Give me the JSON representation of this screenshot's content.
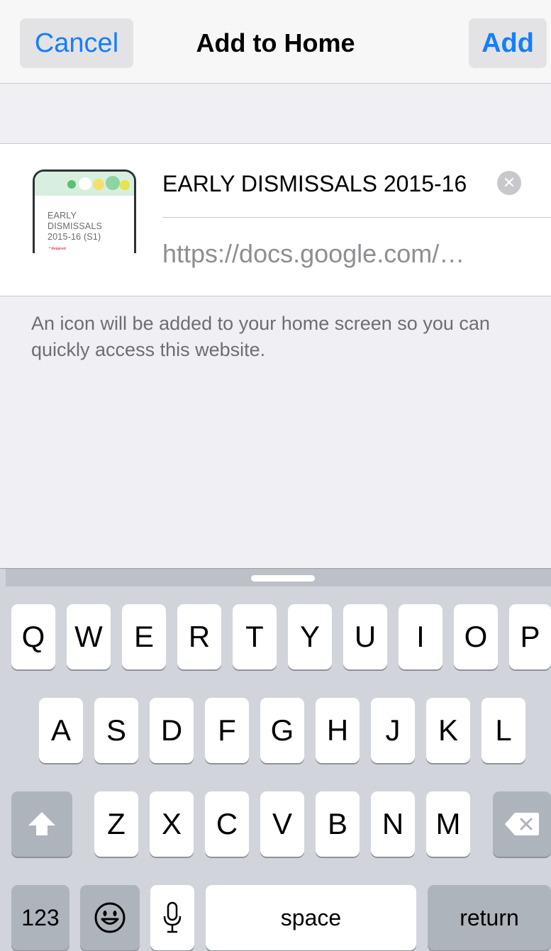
{
  "navbar": {
    "cancel_label": "Cancel",
    "title": "Add to Home",
    "add_label": "Add"
  },
  "bookmark": {
    "thumbnail_lines": [
      "EARLY",
      "DISMISSALS",
      "2015-16 (S1)"
    ],
    "thumbnail_required": "* Required",
    "title_value": "EARLY DISMISSALS 2015-16",
    "clear_icon": "clear-circle-icon",
    "url": "https://docs.google.com/…"
  },
  "info_text": "An icon will be added to your home screen so you can quickly access this website.",
  "keyboard": {
    "row1": [
      "Q",
      "W",
      "E",
      "R",
      "T",
      "Y",
      "U",
      "I",
      "O",
      "P"
    ],
    "row2": [
      "A",
      "S",
      "D",
      "F",
      "G",
      "H",
      "J",
      "K",
      "L"
    ],
    "row3": [
      "Z",
      "X",
      "C",
      "V",
      "B",
      "N",
      "M"
    ],
    "numbers_label": "123",
    "space_label": "space",
    "return_label": "return",
    "shift_icon": "shift-arrow-icon",
    "delete_icon": "backspace-icon",
    "emoji_icon": "emoji-icon",
    "mic_icon": "microphone-icon"
  },
  "colors": {
    "accent": "#147efb",
    "keyboard_bg": "#d1d5db",
    "key_bg": "#ffffff",
    "key_dark_bg": "#aeb4bc"
  }
}
